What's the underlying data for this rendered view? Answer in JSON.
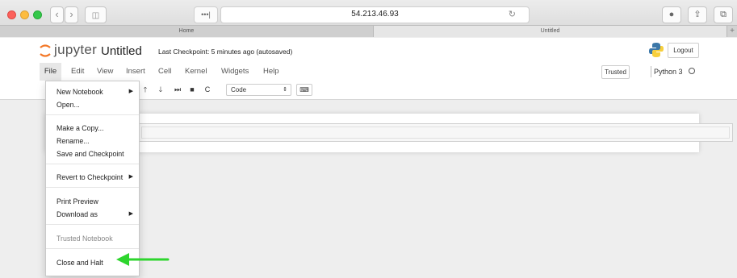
{
  "browser": {
    "address": "54.213.46.93",
    "tabs": [
      {
        "label": "Home"
      },
      {
        "label": "Untitled"
      }
    ],
    "new_tab": "+"
  },
  "app": {
    "logo_text": "jupyter",
    "notebook_title": "Untitled",
    "checkpoint_status": "Last Checkpoint: 5 minutes ago (autosaved)",
    "logout_label": "Logout",
    "menu": [
      "File",
      "Edit",
      "View",
      "Insert",
      "Cell",
      "Kernel",
      "Widgets",
      "Help"
    ],
    "trusted_label": "Trusted",
    "kernel_name": "Python 3",
    "cell_type": "Code"
  },
  "file_menu": {
    "new_notebook": "New Notebook",
    "open": "Open...",
    "make_copy": "Make a Copy...",
    "rename": "Rename...",
    "save_checkpoint": "Save and Checkpoint",
    "revert_checkpoint": "Revert to Checkpoint",
    "print_preview": "Print Preview",
    "download_as": "Download as",
    "trusted_notebook": "Trusted Notebook",
    "close_halt": "Close and Halt"
  },
  "colors": {
    "accent_arrow": "#2ed52e",
    "jupyter_orange": "#f37726"
  }
}
